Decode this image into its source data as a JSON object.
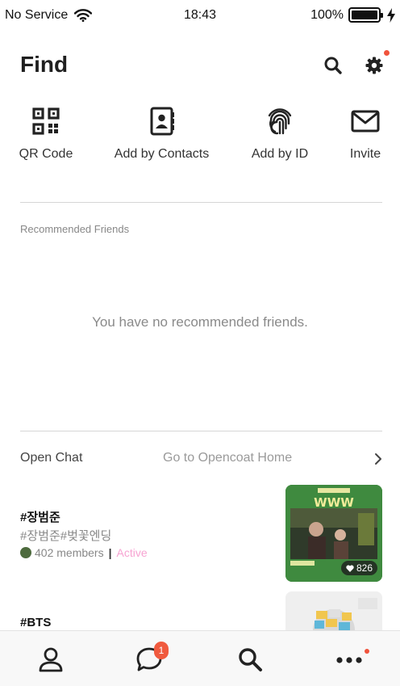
{
  "status": {
    "carrier": "No Service",
    "time": "18:43",
    "battery": "100%",
    "battery_level": 1.0
  },
  "header": {
    "title": "Find"
  },
  "actions": [
    {
      "label": "QR Code",
      "icon": "qr-code-icon"
    },
    {
      "label": "Add by Contacts",
      "icon": "contacts-book-icon"
    },
    {
      "label": "Add by ID",
      "icon": "fingerprint-icon"
    },
    {
      "label": "Invite",
      "icon": "envelope-icon"
    }
  ],
  "recommended": {
    "label": "Recommended Friends",
    "empty": "You have no recommended friends."
  },
  "openchat": {
    "title": "Open Chat",
    "link": "Go to Opencoat Home",
    "rooms": [
      {
        "name": "#장범준",
        "tags": "#장범준#벚꽃엔딩",
        "members": "402 members",
        "status": "Active",
        "thumb_text": "WWW",
        "likes": "826"
      },
      {
        "name": "#BTS"
      }
    ]
  },
  "tabbar": {
    "chat_badge": "1"
  },
  "colors": {
    "accent_red": "#f05a3e",
    "active_pink": "#f7a3d2",
    "thumb_green": "#3f8a3f"
  }
}
